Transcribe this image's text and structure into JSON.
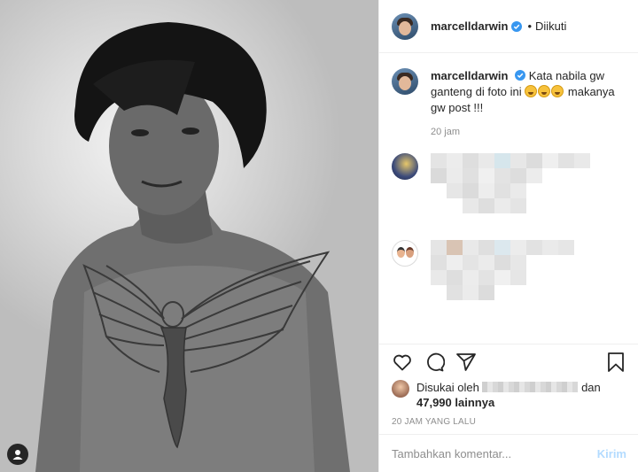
{
  "post": {
    "username": "marcelldarwin",
    "follow_separator": "•",
    "follow_status": "Diikuti"
  },
  "caption": {
    "username": "marcelldarwin",
    "text_before_emoji": "Kata nabila gw ganteng di foto ini",
    "emoji_count": 3,
    "text_after_emoji": "makanya gw post !!!",
    "time": "20 jam"
  },
  "likes": {
    "prefix": "Disukai oleh",
    "conjunction": "dan",
    "others_count": "47,990 lainnya"
  },
  "post_time": "20 JAM YANG LALU",
  "comment_input": {
    "placeholder": "Tambahkan komentar...",
    "post_label": "Kirim"
  },
  "icons": {
    "like": "heart-icon",
    "comment": "comment-icon",
    "share": "share-icon",
    "save": "bookmark-icon",
    "verified": "verified-badge-icon",
    "user_tags": "user-tag-icon"
  },
  "colors": {
    "verified_blue": "#3897f0",
    "post_button_disabled": "#b3dbff",
    "muted_text": "#8e8e8e"
  }
}
